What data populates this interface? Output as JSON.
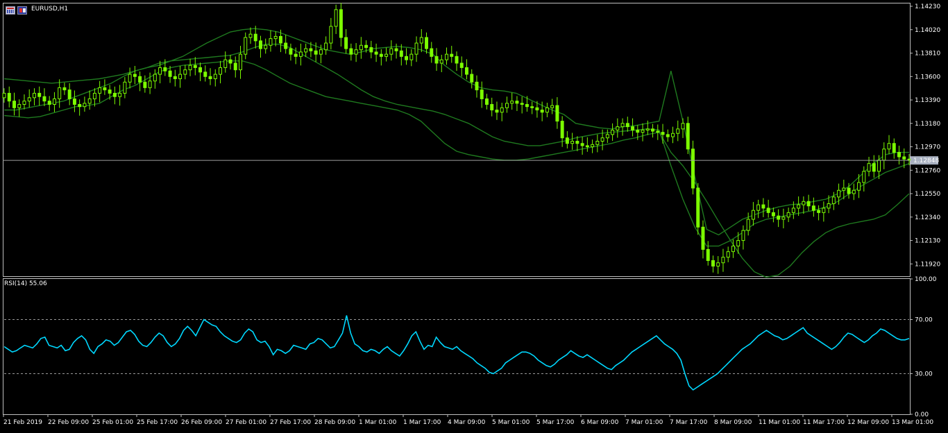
{
  "header": {
    "symbol_label": "EURUSD,H1"
  },
  "rsi_panel": {
    "label": "RSI(14) 55.06"
  },
  "colors": {
    "background": "#000000",
    "grid_frame": "#c0c0c0",
    "candles": "#7CFC00",
    "bollinger": "#1f7a1f",
    "rsi_line": "#00d8ff",
    "current_price_line": "#a0a0a0",
    "current_price_box": "#a8b0c0"
  },
  "chart_data": [
    {
      "type": "candlestick",
      "symbol": "EURUSD",
      "timeframe": "H1",
      "ylim": [
        1.1181,
        1.14255
      ],
      "y_ticks": [
        "1.14230",
        "1.14020",
        "1.13810",
        "1.13600",
        "1.13390",
        "1.13180",
        "1.12970",
        "1.12760",
        "1.12550",
        "1.12340",
        "1.12130",
        "1.11920"
      ],
      "current_price": "1.12848",
      "x_ticks": [
        "21 Feb 2019",
        "22 Feb 09:00",
        "25 Feb 01:00",
        "25 Feb 17:00",
        "26 Feb 09:00",
        "27 Feb 01:00",
        "27 Feb 17:00",
        "28 Feb 09:00",
        "1 Mar 01:00",
        "1 Mar 17:00",
        "4 Mar 09:00",
        "5 Mar 01:00",
        "5 Mar 17:00",
        "6 Mar 09:00",
        "7 Mar 01:00",
        "7 Mar 17:00",
        "8 Mar 09:00",
        "11 Mar 01:00",
        "11 Mar 17:00",
        "12 Mar 09:00",
        "13 Mar 01:00"
      ],
      "series": [
        {
          "type": "line",
          "values": [
            1.1345,
            1.1338,
            1.1332,
            1.1335,
            1.1338,
            1.1341,
            1.1345,
            1.1342,
            1.1338,
            1.1335,
            1.134,
            1.135,
            1.1348,
            1.134,
            1.1335,
            1.1333,
            1.1336,
            1.134,
            1.1345,
            1.135,
            1.1348,
            1.1345,
            1.1342,
            1.1345,
            1.1355,
            1.1362,
            1.136,
            1.1355,
            1.135,
            1.1356,
            1.1362,
            1.1368,
            1.1365,
            1.136,
            1.1358,
            1.1362,
            1.1366,
            1.137,
            1.1368,
            1.1364,
            1.136,
            1.1358,
            1.1362,
            1.1368,
            1.1375,
            1.1372,
            1.1366,
            1.138,
            1.1395,
            1.1398,
            1.1392,
            1.1385,
            1.1388,
            1.1394,
            1.1396,
            1.139,
            1.1385,
            1.138,
            1.1378,
            1.1382,
            1.1385,
            1.1383,
            1.138,
            1.1384,
            1.139,
            1.1405,
            1.142,
            1.1395,
            1.1385,
            1.138,
            1.1384,
            1.1388,
            1.1386,
            1.1382,
            1.138,
            1.1378,
            1.138,
            1.1385,
            1.1383,
            1.1378,
            1.1375,
            1.138,
            1.139,
            1.1395,
            1.1385,
            1.1378,
            1.1372,
            1.1375,
            1.138,
            1.1378,
            1.1372,
            1.1368,
            1.1362,
            1.1355,
            1.1348,
            1.134,
            1.1335,
            1.133,
            1.1328,
            1.1332,
            1.1336,
            1.1338,
            1.1336,
            1.1335,
            1.1333,
            1.1332,
            1.133,
            1.1328,
            1.1332,
            1.1334,
            1.132,
            1.1305,
            1.13,
            1.1302,
            1.13,
            1.1298,
            1.1297,
            1.1299,
            1.1302,
            1.1305,
            1.1308,
            1.1312,
            1.1315,
            1.1318,
            1.1315,
            1.1312,
            1.131,
            1.1312,
            1.1313,
            1.1311,
            1.131,
            1.1308,
            1.1306,
            1.1309,
            1.1313,
            1.1318,
            1.1295,
            1.126,
            1.1225,
            1.1205,
            1.1195,
            1.119,
            1.1193,
            1.1198,
            1.1203,
            1.1208,
            1.1213,
            1.1222,
            1.1232,
            1.124,
            1.1245,
            1.1242,
            1.1238,
            1.1235,
            1.1232,
            1.1234,
            1.1238,
            1.1242,
            1.1245,
            1.1248,
            1.1244,
            1.124,
            1.1238,
            1.1242,
            1.1246,
            1.1252,
            1.1258,
            1.126,
            1.1255,
            1.1258,
            1.1265,
            1.1275,
            1.1282,
            1.1275,
            1.1285,
            1.1295,
            1.13,
            1.1292,
            1.1288,
            1.1286,
            1.1285
          ]
        },
        {
          "type": "line",
          "values": [
            1.1358,
            1.1357,
            1.1356,
            1.1355,
            1.1354,
            1.1355,
            1.1356,
            1.1357,
            1.1358,
            1.136,
            1.1362,
            1.1365,
            1.1368,
            1.137,
            1.1374,
            1.1378,
            1.1384,
            1.139,
            1.1395,
            1.14,
            1.1402,
            1.1403,
            1.1402,
            1.14,
            1.1396,
            1.1392,
            1.1388,
            1.1384,
            1.1382,
            1.138,
            1.1382,
            1.1385,
            1.1386,
            1.1387,
            1.1386,
            1.1384,
            1.138,
            1.137,
            1.1362,
            1.1355,
            1.135,
            1.1348,
            1.1347,
            1.1345,
            1.134,
            1.1335,
            1.133,
            1.1326,
            1.1318,
            1.1316,
            1.1314,
            1.1313,
            1.1315,
            1.1316,
            1.1318,
            1.132,
            1.1365,
            1.132,
            1.127,
            1.1223,
            1.1218,
            1.1225,
            1.1232,
            1.1236,
            1.124,
            1.1243,
            1.1245,
            1.1246,
            1.1248,
            1.125,
            1.1255,
            1.1262,
            1.1272,
            1.1282,
            1.129,
            1.1292,
            1.1292
          ]
        },
        {
          "type": "line",
          "values": [
            1.133,
            1.133,
            1.1332,
            1.1334,
            1.1336,
            1.1338,
            1.1342,
            1.1346,
            1.135,
            1.1354,
            1.136,
            1.1365,
            1.1368,
            1.1372,
            1.1374,
            1.1375,
            1.1376,
            1.1377,
            1.1378,
            1.1379,
            1.1382,
            1.1386,
            1.1389,
            1.1389,
            1.1386,
            1.138,
            1.1374,
            1.1368,
            1.1362,
            1.1355,
            1.1348,
            1.1342,
            1.1338,
            1.1335,
            1.1333,
            1.1331,
            1.1329,
            1.1326,
            1.1322,
            1.1318,
            1.1312,
            1.1306,
            1.1302,
            1.13,
            1.1298,
            1.1298,
            1.13,
            1.1302,
            1.1305,
            1.1307,
            1.1309,
            1.131,
            1.1311,
            1.1312,
            1.1313,
            1.1312,
            1.128,
            1.125,
            1.1225,
            1.1208,
            1.1208,
            1.1213,
            1.122,
            1.1228,
            1.1232,
            1.1234,
            1.1236,
            1.1238,
            1.124,
            1.1243,
            1.1248,
            1.1255,
            1.1262,
            1.1268,
            1.1274,
            1.1278,
            1.1282
          ]
        },
        {
          "type": "line",
          "values": [
            1.1325,
            1.1324,
            1.1323,
            1.1324,
            1.1327,
            1.133,
            1.1333,
            1.1334,
            1.1336,
            1.1342,
            1.1348,
            1.1352,
            1.1358,
            1.1364,
            1.1368,
            1.137,
            1.1371,
            1.1372,
            1.1373,
            1.1374,
            1.1374,
            1.1371,
            1.1366,
            1.136,
            1.1354,
            1.135,
            1.1346,
            1.1342,
            1.134,
            1.1338,
            1.1336,
            1.1334,
            1.1332,
            1.133,
            1.1326,
            1.132,
            1.131,
            1.13,
            1.1293,
            1.129,
            1.1288,
            1.1286,
            1.1285,
            1.1285,
            1.1286,
            1.1288,
            1.129,
            1.1292,
            1.1294,
            1.1296,
            1.1298,
            1.13,
            1.1303,
            1.1305,
            1.1308,
            1.131,
            1.1292,
            1.128,
            1.1265,
            1.1248,
            1.123,
            1.1213,
            1.1197,
            1.1185,
            1.118,
            1.1182,
            1.119,
            1.1202,
            1.1212,
            1.122,
            1.1225,
            1.1228,
            1.123,
            1.1232,
            1.1236,
            1.1245,
            1.1255
          ]
        },
        {
          "type": "line",
          "values": [
            50,
            48,
            46,
            47,
            49,
            51,
            50,
            49,
            52,
            56,
            57,
            51,
            50,
            49,
            51,
            47,
            48,
            53,
            56,
            58,
            55,
            48,
            45,
            50,
            52,
            55,
            54,
            51,
            53,
            57,
            61,
            62,
            59,
            54,
            51,
            50,
            53,
            57,
            60,
            58,
            53,
            50,
            52,
            56,
            62,
            65,
            62,
            58,
            64,
            70,
            68,
            66,
            65,
            61,
            58,
            56,
            54,
            53,
            55,
            60,
            63,
            61,
            55,
            53,
            54,
            50,
            44,
            48,
            47,
            45,
            47,
            51,
            50,
            49,
            48,
            52,
            53,
            56,
            55,
            52,
            49,
            50,
            55,
            60,
            73,
            60,
            52,
            50,
            47,
            46,
            48,
            47,
            45,
            48,
            50,
            47,
            45,
            43,
            47,
            52,
            58,
            61,
            54,
            48,
            51,
            50,
            57,
            53,
            50,
            49,
            48,
            50,
            47,
            45,
            43,
            41,
            38,
            36,
            34,
            31,
            30,
            32,
            34,
            38,
            40,
            42,
            44,
            46,
            46,
            45,
            43,
            40,
            38,
            36,
            35,
            37,
            40,
            42,
            44,
            47,
            45,
            43,
            42,
            44,
            42,
            40,
            38,
            36,
            34,
            33,
            36,
            38,
            40,
            43,
            46,
            48,
            50,
            52,
            54,
            56,
            58,
            55,
            52,
            50,
            48,
            45,
            40,
            30,
            21,
            18,
            20,
            22,
            24,
            26,
            28,
            30,
            33,
            36,
            39,
            42,
            45,
            48,
            50,
            52,
            55,
            58,
            60,
            62,
            60,
            58,
            57,
            55,
            56,
            58,
            60,
            62,
            64,
            60,
            58,
            56,
            54,
            52,
            50,
            48,
            50,
            53,
            57,
            60,
            59,
            57,
            55,
            53,
            55,
            58,
            60,
            63,
            62,
            60,
            58,
            56,
            55,
            55,
            56
          ]
        }
      ]
    },
    {
      "type": "line",
      "title": "RSI(14) 55.06",
      "ylim": [
        0,
        100
      ],
      "y_ticks": [
        "100.00",
        "70.00",
        "30.00",
        "0.00"
      ],
      "levels": [
        70,
        30
      ],
      "x_ticks": [
        "21 Feb 2019",
        "22 Feb 09:00",
        "25 Feb 01:00",
        "25 Feb 17:00",
        "26 Feb 09:00",
        "27 Feb 01:00",
        "27 Feb 17:00",
        "28 Feb 09:00",
        "1 Mar 01:00",
        "1 Mar 17:00",
        "4 Mar 09:00",
        "5 Mar 01:00",
        "5 Mar 17:00",
        "6 Mar 09:00",
        "7 Mar 01:00",
        "7 Mar 17:00",
        "8 Mar 09:00",
        "11 Mar 01:00",
        "11 Mar 17:00",
        "12 Mar 09:00",
        "13 Mar 01:00"
      ]
    }
  ]
}
